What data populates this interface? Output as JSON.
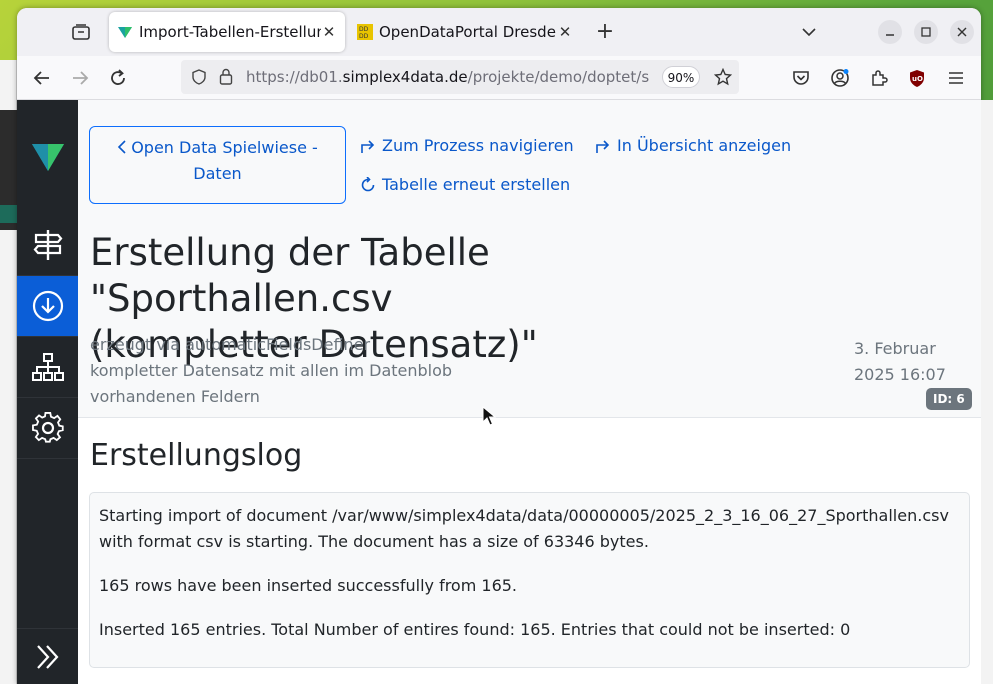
{
  "browser": {
    "tabs": [
      {
        "title": "Import-Tabellen-Erstellun",
        "active": true
      },
      {
        "title": "OpenDataPortal Dresden",
        "active": false
      }
    ],
    "url": {
      "prefix": "https://db01.",
      "host": "simplex4data.de",
      "path": "/projekte/demo/doptet/s"
    },
    "zoom": "90%"
  },
  "sidebar": {
    "items": [
      {
        "icon": "logo-icon"
      },
      {
        "icon": "signpost-icon"
      },
      {
        "icon": "download-icon",
        "active": true
      },
      {
        "icon": "sitemap-icon"
      },
      {
        "icon": "gear-icon"
      },
      {
        "icon": "expand-icon"
      }
    ]
  },
  "header": {
    "back_label_line1": "Open Data Spielwiese -",
    "back_label_line2": "Daten",
    "nav_process": "Zum Prozess navigieren",
    "nav_overview": "In Übersicht anzeigen",
    "recreate": "Tabelle erneut erstellen",
    "title_line1": "Erstellung der Tabelle \"Sporthallen.csv",
    "title_line2": "(kompletter Datensatz)\"",
    "meta_line1": "erzeugt via automaticFieldsDefiner",
    "meta_line2": "kompletter Datensatz mit allen im Datenblob",
    "meta_line3": "vorhandenen Feldern",
    "date_line1": "3. Februar",
    "date_line2": "2025 16:07",
    "id_badge": "ID: 6"
  },
  "log": {
    "title": "Erstellungslog",
    "line1": "Starting import of document /var/www/simplex4data/data/00000005/2025_2_3_16_06_27_Sporthallen.csv with format csv is starting. The document has a size of 63346 bytes.",
    "line2": "165 rows have been inserted successfully from 165.",
    "line3": "Inserted 165 entries. Total Number of entires found: 165. Entries that could not be inserted: 0"
  },
  "colors": {
    "sidebar_bg": "#212529",
    "active": "#0b5ed7",
    "link": "#0a58ca"
  }
}
